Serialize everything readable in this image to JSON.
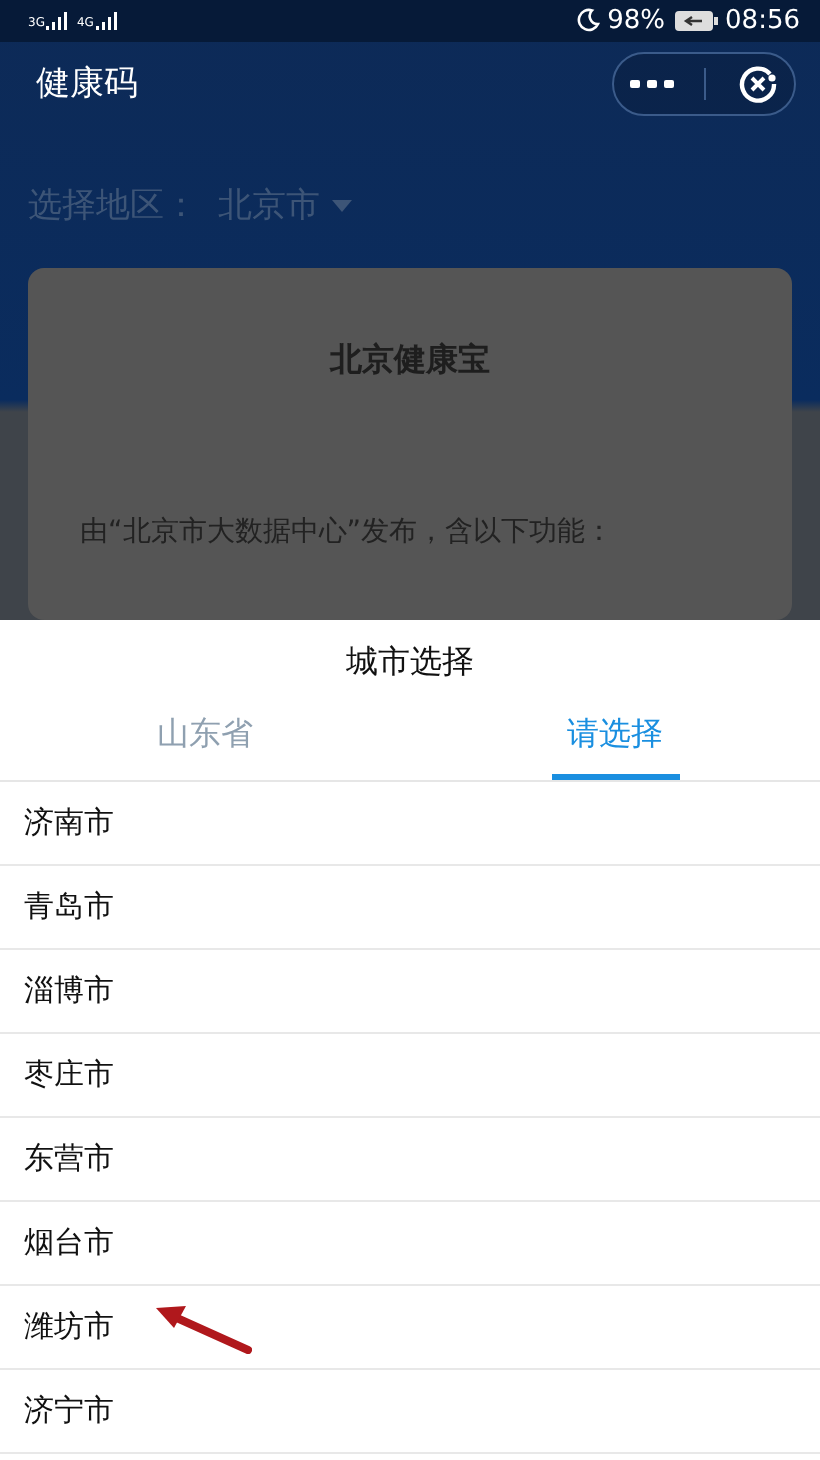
{
  "status_bar": {
    "signal_labels": [
      "3G",
      "4G"
    ],
    "battery": "98%",
    "time": "08:56"
  },
  "header": {
    "title": "健康码"
  },
  "region": {
    "label": "选择地区：",
    "value": "北京市"
  },
  "card": {
    "title": "北京健康宝",
    "description": "由“北京市大数据中心”发布，含以下功能："
  },
  "sheet": {
    "title": "城市选择",
    "tabs": [
      {
        "label": "山东省",
        "selected": false
      },
      {
        "label": "请选择",
        "selected": true
      }
    ],
    "cities": [
      {
        "name": "济南市",
        "marked": false
      },
      {
        "name": "青岛市",
        "marked": false
      },
      {
        "name": "淄博市",
        "marked": false
      },
      {
        "name": "枣庄市",
        "marked": false
      },
      {
        "name": "东营市",
        "marked": false
      },
      {
        "name": "烟台市",
        "marked": false
      },
      {
        "name": "潍坊市",
        "marked": true
      },
      {
        "name": "济宁市",
        "marked": false
      }
    ]
  }
}
